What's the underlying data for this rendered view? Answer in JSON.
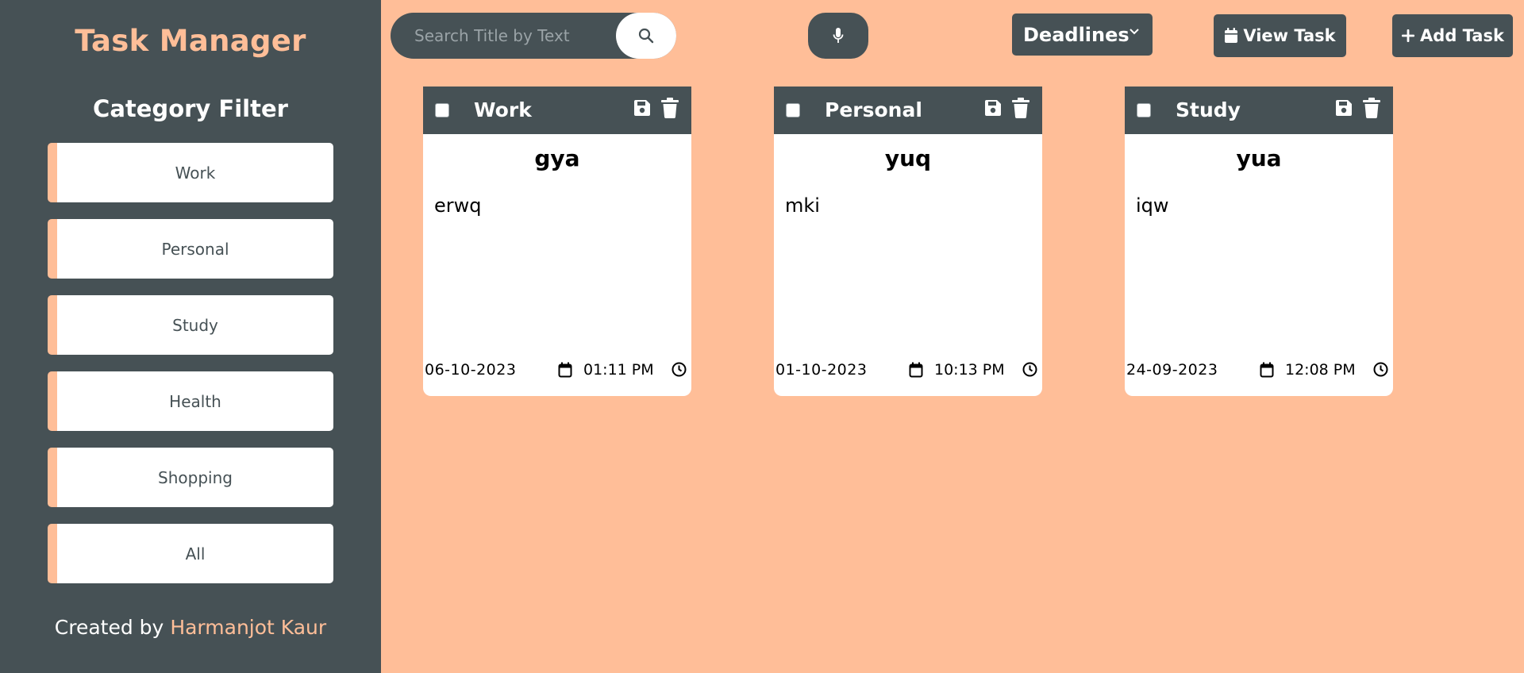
{
  "app": {
    "title": "Task Manager"
  },
  "sidebar": {
    "filter_heading": "Category Filter",
    "categories": [
      {
        "label": "Work"
      },
      {
        "label": "Personal"
      },
      {
        "label": "Study"
      },
      {
        "label": "Health"
      },
      {
        "label": "Shopping"
      },
      {
        "label": "All"
      }
    ],
    "credit_prefix": "Created by",
    "credit_author": "Harmanjot Kaur"
  },
  "toolbar": {
    "search_placeholder": "Search Title by Text",
    "search_value": "",
    "deadlines_label": "Deadlines",
    "view_task_label": "View Task",
    "add_task_label": "Add Task"
  },
  "tasks": [
    {
      "category": "Work",
      "title": "gya",
      "description": "erwq",
      "date": "06-10-2023",
      "time": "01:11 PM",
      "checked": false
    },
    {
      "category": "Personal",
      "title": "yuq",
      "description": "mki",
      "date": "01-10-2023",
      "time": "10:13 PM",
      "checked": false
    },
    {
      "category": "Study",
      "title": "yua",
      "description": "iqw",
      "date": "24-09-2023",
      "time": "12:08 PM",
      "checked": false
    }
  ],
  "icons": {
    "search": "search-icon",
    "mic": "microphone-icon",
    "chevron": "chevron-down-icon",
    "view_task": "calendar-icon",
    "add_task": "plus-icon",
    "save": "floppy-disk-icon",
    "trash": "trash-icon",
    "date": "calendar-icon",
    "time": "clock-icon"
  },
  "colors": {
    "accent": "#ffbe98",
    "dark": "#465155",
    "card": "#ffffff",
    "background": "#ffbe98"
  }
}
